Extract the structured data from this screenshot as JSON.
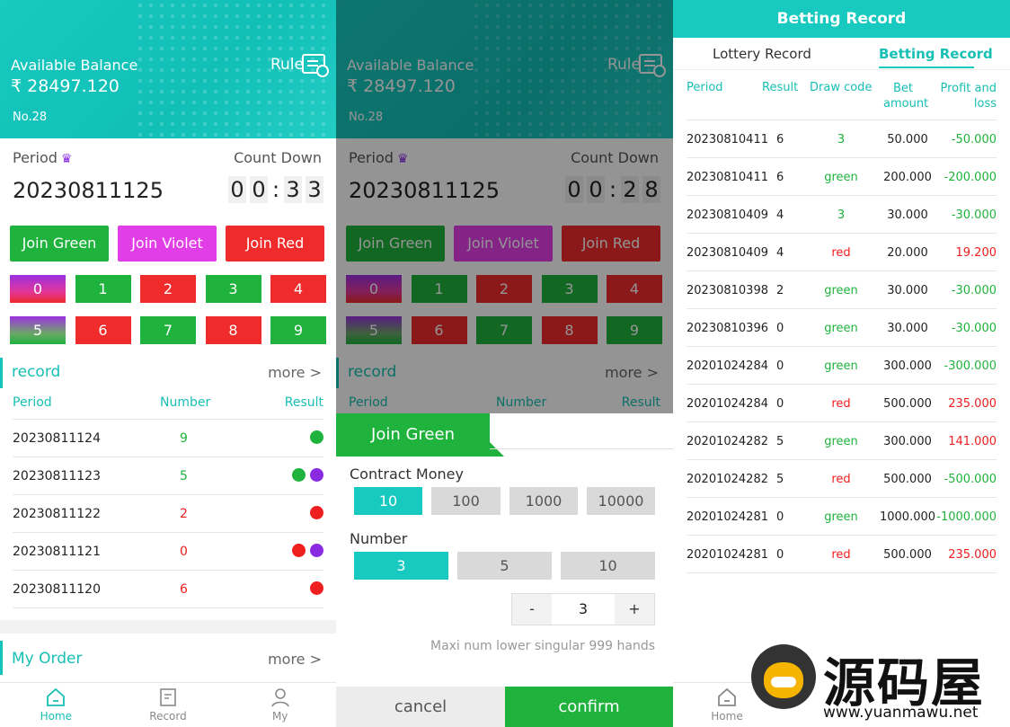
{
  "balance_label": "Available Balance",
  "balance": "₹ 28497.120",
  "rule_label": "Rule",
  "room_no": "No.28",
  "period_label": "Period",
  "countdown_label": "Count Down",
  "period_value": "20230811125",
  "countdown_left": [
    "0",
    "0",
    "3",
    "3"
  ],
  "countdown_mid": [
    "0",
    "0",
    "2",
    "8"
  ],
  "joins": [
    "Join Green",
    "Join Violet",
    "Join Red"
  ],
  "numbers": [
    "0",
    "1",
    "2",
    "3",
    "4",
    "5",
    "6",
    "7",
    "8",
    "9"
  ],
  "record": {
    "title": "record",
    "more": "more >",
    "headers": [
      "Period",
      "Number",
      "Result"
    ],
    "rows": [
      {
        "period": "20230811124",
        "number": "9",
        "color": "green",
        "dots": [
          "g"
        ]
      },
      {
        "period": "20230811123",
        "number": "5",
        "color": "green",
        "dots": [
          "g",
          "v"
        ]
      },
      {
        "period": "20230811122",
        "number": "2",
        "color": "red",
        "dots": [
          "r"
        ]
      },
      {
        "period": "20230811121",
        "number": "0",
        "color": "red",
        "dots": [
          "r",
          "v"
        ]
      },
      {
        "period": "20230811120",
        "number": "6",
        "color": "red",
        "dots": [
          "r"
        ]
      }
    ]
  },
  "my_order": {
    "title": "My Order",
    "more": "more >"
  },
  "tabs": [
    {
      "label": "Home",
      "icon": "home-icon"
    },
    {
      "label": "Record",
      "icon": "record-icon"
    },
    {
      "label": "My",
      "icon": "user-icon"
    }
  ],
  "sheet": {
    "title": "Join Green",
    "contract_label": "Contract Money",
    "contract_options": [
      "10",
      "100",
      "1000",
      "10000"
    ],
    "number_label": "Number",
    "number_options": [
      "3",
      "5",
      "10"
    ],
    "minus": "-",
    "quantity": "3",
    "plus": "+",
    "maxi": "Maxi num lower singular 999 hands",
    "cancel": "cancel",
    "confirm": "confirm"
  },
  "betting": {
    "title": "Betting Record",
    "tab_lottery": "Lottery Record",
    "tab_betting": "Betting Record",
    "headers": [
      "Period",
      "Result",
      "Draw code",
      "Bet amount",
      "Profit and loss"
    ],
    "rows": [
      {
        "period": "20230810411",
        "result": "6",
        "code": "3",
        "code_color": "green",
        "bet": "50.000",
        "pl": "-50.000",
        "pl_color": "neg"
      },
      {
        "period": "20230810411",
        "result": "6",
        "code": "green",
        "code_color": "green",
        "bet": "200.000",
        "pl": "-200.000",
        "pl_color": "neg"
      },
      {
        "period": "20230810409",
        "result": "4",
        "code": "3",
        "code_color": "green",
        "bet": "30.000",
        "pl": "-30.000",
        "pl_color": "neg"
      },
      {
        "period": "20230810409",
        "result": "4",
        "code": "red",
        "code_color": "red",
        "bet": "20.000",
        "pl": "19.200",
        "pl_color": "pos"
      },
      {
        "period": "20230810398",
        "result": "2",
        "code": "green",
        "code_color": "green",
        "bet": "30.000",
        "pl": "-30.000",
        "pl_color": "neg"
      },
      {
        "period": "20230810396",
        "result": "0",
        "code": "green",
        "code_color": "green",
        "bet": "30.000",
        "pl": "-30.000",
        "pl_color": "neg"
      },
      {
        "period": "20201024284",
        "result": "0",
        "code": "green",
        "code_color": "green",
        "bet": "300.000",
        "pl": "-300.000",
        "pl_color": "neg"
      },
      {
        "period": "20201024284",
        "result": "0",
        "code": "red",
        "code_color": "red",
        "bet": "500.000",
        "pl": "235.000",
        "pl_color": "pos"
      },
      {
        "period": "20201024282",
        "result": "5",
        "code": "green",
        "code_color": "green",
        "bet": "300.000",
        "pl": "141.000",
        "pl_color": "pos"
      },
      {
        "period": "20201024282",
        "result": "5",
        "code": "red",
        "code_color": "red",
        "bet": "500.000",
        "pl": "-500.000",
        "pl_color": "neg"
      },
      {
        "period": "20201024281",
        "result": "0",
        "code": "green",
        "code_color": "green",
        "bet": "1000.000",
        "pl": "-1000.000",
        "pl_color": "neg"
      },
      {
        "period": "20201024281",
        "result": "0",
        "code": "red",
        "code_color": "red",
        "bet": "500.000",
        "pl": "235.000",
        "pl_color": "pos"
      }
    ]
  },
  "home_tab": "Home",
  "watermark": {
    "cn": "源码屋",
    "url": "www.yuanmawu.net"
  },
  "colors": {
    "teal": "#17c9bf",
    "green": "#1fb33d",
    "red": "#ef2b2b",
    "violet": "#e23ee7"
  }
}
